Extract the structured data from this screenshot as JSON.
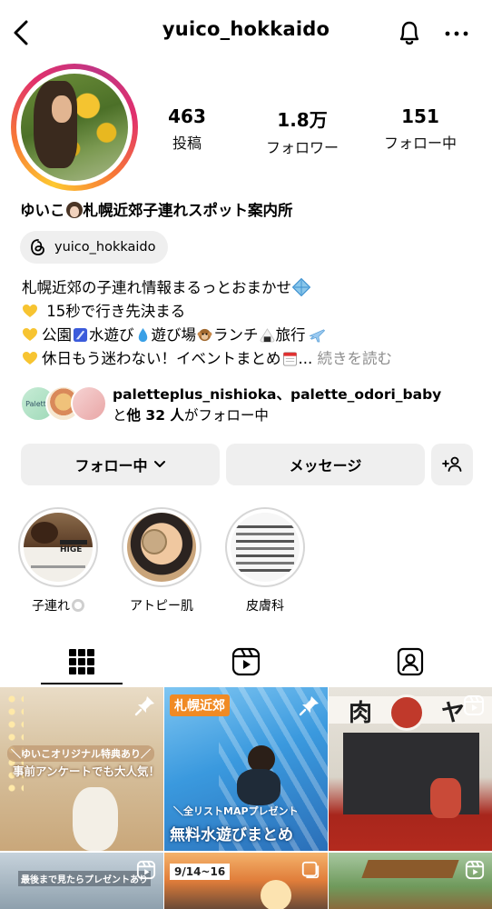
{
  "header": {
    "username": "yuico_hokkaido"
  },
  "stats": [
    {
      "value": "463",
      "label": "投稿"
    },
    {
      "value": "1.8万",
      "label": "フォロワー"
    },
    {
      "value": "151",
      "label": "フォロー中"
    }
  ],
  "profile": {
    "name_prefix": "ゆいこ",
    "name_suffix": "札幌近郊子連れスポット案内所",
    "threads_handle": "yuico_hokkaido"
  },
  "bio": {
    "line1": "札幌近郊の子連れ情報まるっとおまかせ",
    "line2": " 15秒で行き先決まる",
    "line3_a": "公園",
    "line3_b": "水遊び",
    "line3_c": "遊び場",
    "line3_d": "ランチ",
    "line3_e": "旅行",
    "line4": "休日もう迷わない！イベントまとめ",
    "ellipsis": "... ",
    "more": "続きを読む"
  },
  "followed_by": {
    "names": "paletteplus_nishioka、palette_odori_baby",
    "and": "と",
    "count": "他 32 人",
    "suffix": "がフォロー中",
    "avatar1_text": "Palette"
  },
  "buttons": {
    "following": "フォロー中",
    "message": "メッセージ"
  },
  "highlights": [
    {
      "label": "子連れ"
    },
    {
      "label": "アトピー肌"
    },
    {
      "label": "皮膚科"
    }
  ],
  "highlight_texts": {
    "h1_title": "HIGE"
  },
  "grid": {
    "post1_line1": "＼ゆいこオリジナル特典あり／",
    "post1_line2": "事前アンケートでも大人気！",
    "post2_tag": "札幌近郊",
    "post2_line1": "＼全リストMAPプレゼント",
    "post2_line2": "無料水遊びまとめ",
    "post3_sign1": "肉",
    "post3_sign2": "ヤ",
    "post4_text": "最後まで見たらプレゼントあり",
    "post5_date": "9/14~16"
  },
  "colors": {
    "accent": "#0095f6",
    "muted": "#8e8e8e",
    "button_bg": "#efefef"
  }
}
